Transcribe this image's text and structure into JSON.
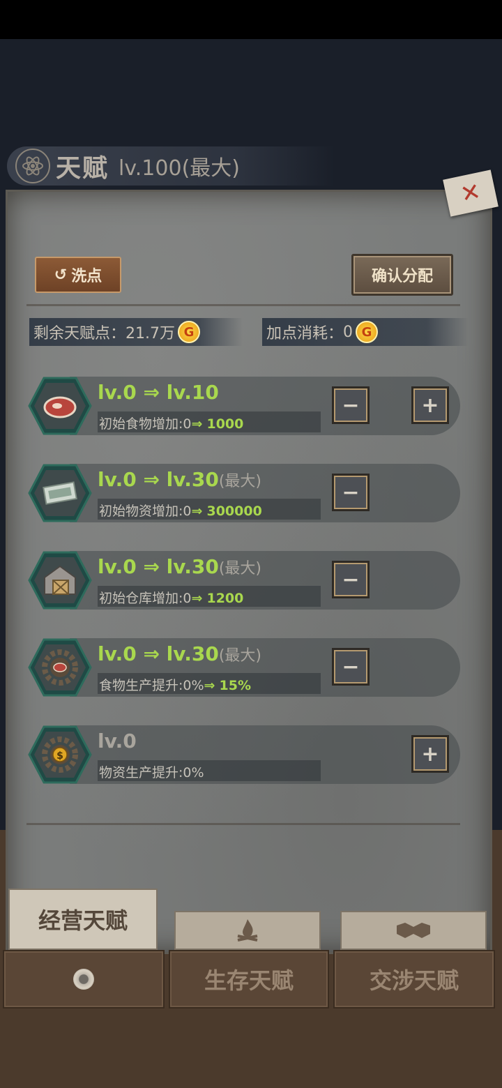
{
  "header": {
    "title": "天赋",
    "level": "lv.100(最大)"
  },
  "actions": {
    "reset_label": "洗点",
    "confirm_label": "确认分配"
  },
  "points": {
    "remaining_label": "剩余天赋点：",
    "remaining_value": "21.7万",
    "cost_label": "加点消耗：",
    "cost_value": "0",
    "coin_glyph": "G"
  },
  "talents": [
    {
      "level_from": "lv.0",
      "arrow": "⇒",
      "level_to": "lv.10",
      "max": "",
      "desc_prefix": "初始食物增加:0",
      "desc_to": "1000",
      "icon": "steak-icon",
      "minus": "−",
      "plus": "+"
    },
    {
      "level_from": "lv.0",
      "arrow": "⇒",
      "level_to": "lv.30",
      "max": "(最大)",
      "desc_prefix": "初始物资增加:0",
      "desc_to": "300000",
      "icon": "cash-icon",
      "minus": "−"
    },
    {
      "level_from": "lv.0",
      "arrow": "⇒",
      "level_to": "lv.30",
      "max": "(最大)",
      "desc_prefix": "初始仓库增加:0",
      "desc_to": "1200",
      "icon": "warehouse-icon",
      "minus": "−"
    },
    {
      "level_from": "lv.0",
      "arrow": "⇒",
      "level_to": "lv.30",
      "max": "(最大)",
      "desc_prefix": "食物生产提升:0%",
      "desc_to": "15%",
      "icon": "gear-food-icon",
      "minus": "−"
    },
    {
      "level_from": "lv.0",
      "desc_prefix": "物资生产提升:0%",
      "icon": "gear-money-icon",
      "plus": "+"
    }
  ],
  "tabs": {
    "active_label": "经营天赋",
    "survival_icon": "campfire-icon",
    "negotiation_icon": "handshake-icon",
    "bottom_survival": "生存天赋",
    "bottom_negotiation": "交涉天赋"
  },
  "colors": {
    "accent_green": "#a9d84e",
    "panel": "#7a7c7b",
    "close_x": "#b23a2e"
  }
}
